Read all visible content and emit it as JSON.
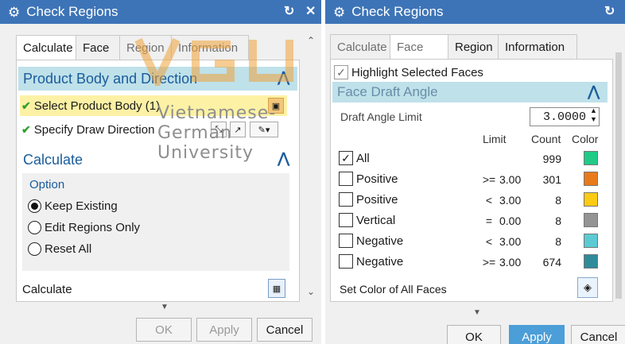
{
  "left_dialog": {
    "title": "Check Regions",
    "tabs": [
      "Calculate",
      "Face",
      "Region",
      "Information"
    ],
    "sections": {
      "product": {
        "header": "Product Body and Direction",
        "select_body": "Select Product Body (1)",
        "draw_direction": "Specify Draw Direction"
      },
      "calculate": {
        "header": "Calculate",
        "option_label": "Option",
        "options": [
          "Keep Existing",
          "Edit Regions Only",
          "Reset All"
        ],
        "selected_option": "Keep Existing",
        "calculate_label": "Calculate"
      }
    },
    "buttons": {
      "ok": "OK",
      "apply": "Apply",
      "cancel": "Cancel"
    }
  },
  "right_dialog": {
    "title": "Check Regions",
    "tabs": [
      "Calculate",
      "Face",
      "Region",
      "Information"
    ],
    "highlight_label": "Highlight Selected Faces",
    "highlight_checked": true,
    "draft_section": {
      "header": "Face Draft Angle",
      "limit_label": "Draft Angle Limit",
      "limit_value": "3.0000",
      "columns": {
        "limit": "Limit",
        "count": "Count",
        "color": "Color"
      },
      "rows": [
        {
          "label": "All",
          "checked": true,
          "op": "",
          "limit": "",
          "count": "999",
          "color": "#1fcb86"
        },
        {
          "label": "Positive",
          "checked": false,
          "op": ">=",
          "limit": "3.00",
          "count": "301",
          "color": "#e87a1c"
        },
        {
          "label": "Positive",
          "checked": false,
          "op": "<",
          "limit": "3.00",
          "count": "8",
          "color": "#fccb14"
        },
        {
          "label": "Vertical",
          "checked": false,
          "op": "=",
          "limit": "0.00",
          "count": "8",
          "color": "#949494"
        },
        {
          "label": "Negative",
          "checked": false,
          "op": "<",
          "limit": "3.00",
          "count": "8",
          "color": "#5ccad3"
        },
        {
          "label": "Negative",
          "checked": false,
          "op": ">=",
          "limit": "3.00",
          "count": "674",
          "color": "#2f8a9a"
        }
      ],
      "set_color_label": "Set Color of All Faces"
    },
    "buttons": {
      "ok": "OK",
      "apply": "Apply",
      "cancel": "Cancel"
    }
  },
  "watermark": {
    "text": "Vietnamese-German University",
    "logo_text": "VGU"
  },
  "colors": {
    "title_bar": "#3d74b7",
    "section_header": "#bfe1ea",
    "accent_text": "#1a5c9b",
    "apply_button": "#4b9ed8"
  }
}
